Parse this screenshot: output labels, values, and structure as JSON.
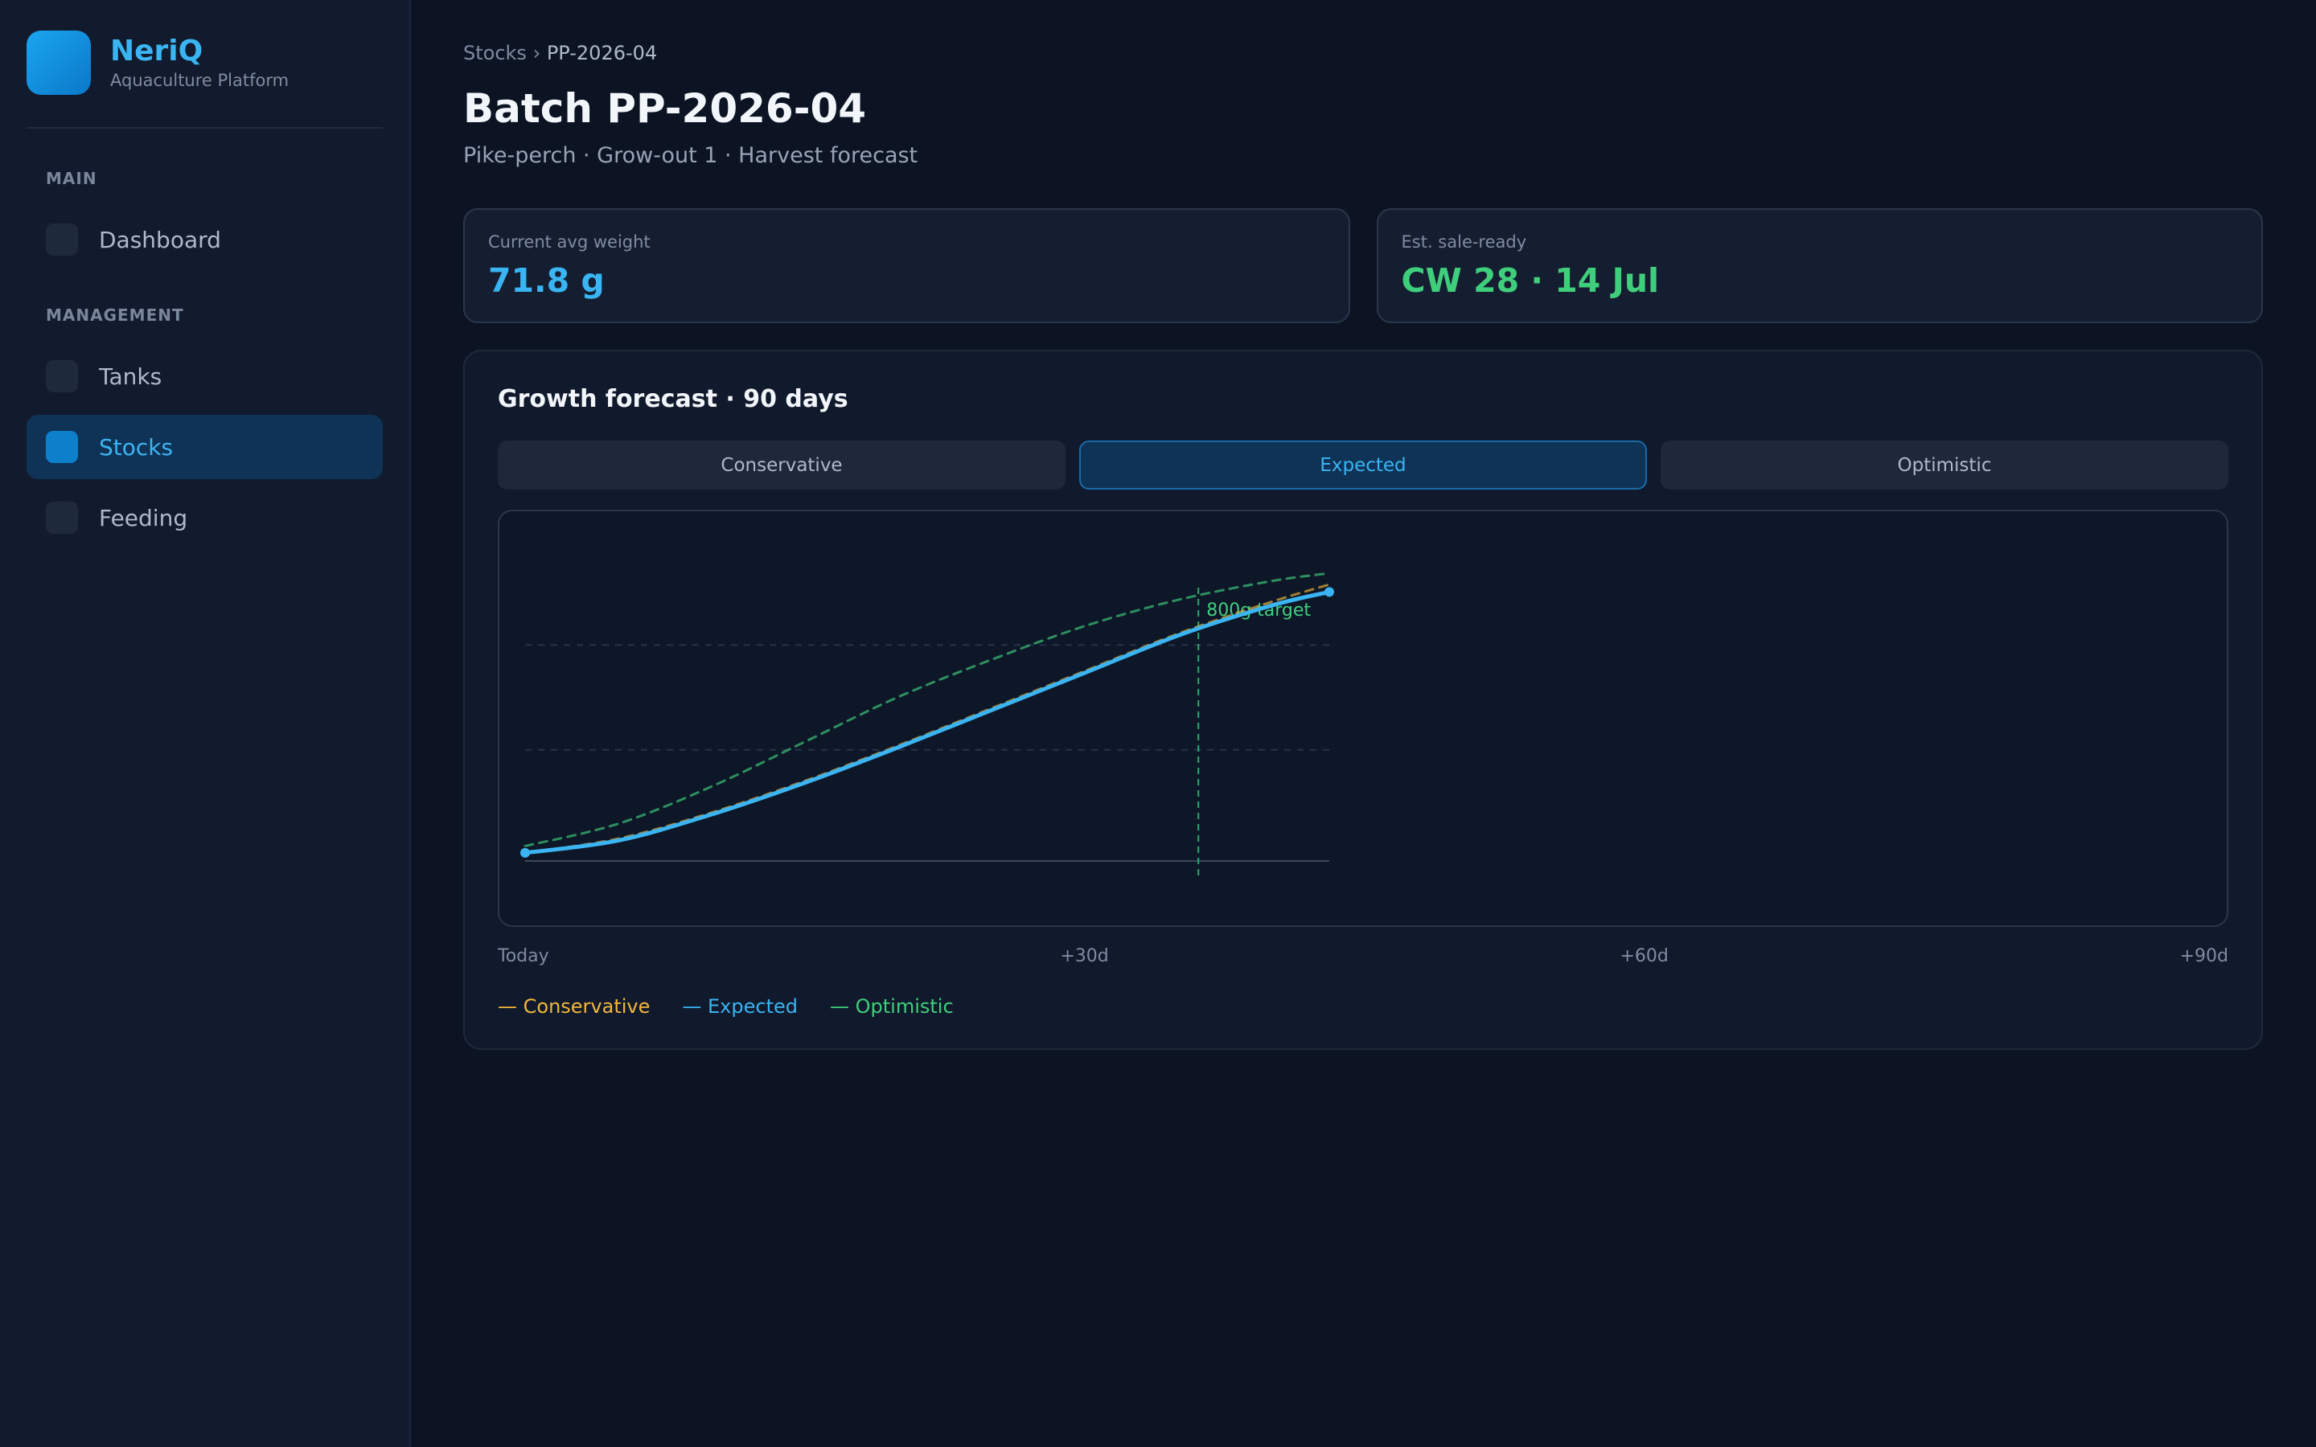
{
  "brand": {
    "name": "NeriQ",
    "subtitle": "Aquaculture Platform"
  },
  "sidebar": {
    "sections": [
      {
        "title": "MAIN",
        "items": [
          {
            "label": "Dashboard",
            "active": false
          }
        ]
      },
      {
        "title": "MANAGEMENT",
        "items": [
          {
            "label": "Tanks",
            "active": false
          },
          {
            "label": "Stocks",
            "active": true
          },
          {
            "label": "Feeding",
            "active": false
          }
        ]
      }
    ]
  },
  "breadcrumb": {
    "parent": "Stocks",
    "separator": "›",
    "current": "PP-2026-04"
  },
  "page": {
    "title": "Batch PP-2026-04",
    "subtitle": "Pike-perch · Grow-out 1 · Harvest forecast"
  },
  "stats": {
    "avg_weight": {
      "label": "Current avg weight",
      "value": "71.8 g"
    },
    "sale_ready": {
      "label": "Est. sale-ready",
      "value": "CW 28 · 14 Jul"
    }
  },
  "forecast": {
    "title": "Growth forecast · 90 days",
    "tabs": [
      "Conservative",
      "Expected",
      "Optimistic"
    ],
    "active_tab": "Expected",
    "x_ticks": [
      "Today",
      "+30d",
      "+60d",
      "+90d"
    ],
    "legend": [
      "— Conservative",
      "— Expected",
      "— Optimistic"
    ]
  },
  "chart_data": {
    "type": "line",
    "target_label": "800g target",
    "target_day": 36,
    "xlim": [
      0,
      43
    ],
    "series": [
      {
        "name": "Conservative",
        "color": "#f1b73b",
        "dashed": true,
        "x": [
          0,
          5,
          10,
          15,
          20,
          25,
          30,
          35,
          40,
          43
        ],
        "y": [
          71.8,
          110,
          180,
          265,
          360,
          460,
          560,
          660,
          745,
          790
        ]
      },
      {
        "name": "Expected",
        "color": "#3ab4f2",
        "dashed": false,
        "x": [
          0,
          5,
          10,
          15,
          20,
          25,
          30,
          35,
          40,
          43
        ],
        "y": [
          71.8,
          105,
          175,
          260,
          355,
          455,
          555,
          655,
          735,
          770
        ]
      },
      {
        "name": "Optimistic",
        "color": "#3fcf7c",
        "dashed": true,
        "x": [
          0,
          5,
          10,
          15,
          20,
          25,
          30,
          35,
          40,
          43
        ],
        "y": [
          90,
          150,
          250,
          370,
          490,
          590,
          680,
          750,
          800,
          820
        ]
      }
    ],
    "ylim": [
      50,
      900
    ],
    "grid": true
  },
  "colors": {
    "accent": "#3ab4f2",
    "success": "#3fcf7c",
    "warning": "#f1b73b",
    "background": "#0c1424"
  }
}
